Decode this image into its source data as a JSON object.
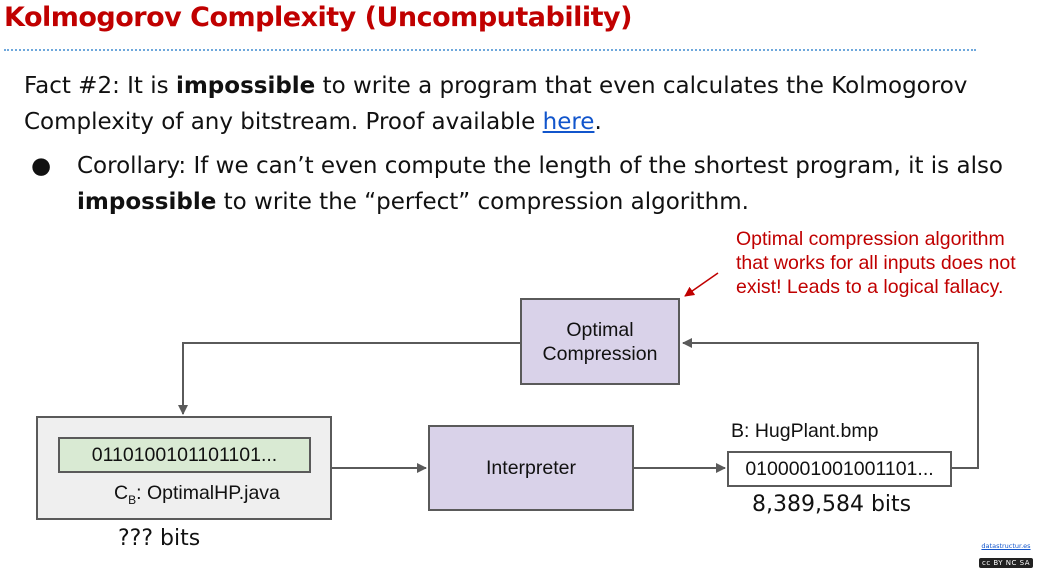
{
  "slide": {
    "title": "Kolmogorov Complexity (Uncomputability)",
    "fact": {
      "prefix": "Fact #2: It is ",
      "bold": "impossible",
      "middle": " to write a program that even calculates the Kolmogorov Complexity of any bitstream. Proof available ",
      "link": "here",
      "suffix": "."
    },
    "bullet": {
      "marker": "●",
      "prefix": "Corollary: If we can’t even compute the length of the shortest program, it is also ",
      "bold": "impossible",
      "suffix": " to write the “perfect” compression algorithm."
    }
  },
  "diagram": {
    "note": "Optimal compression algorithm that works for all inputs does not exist! Leads to a logical fallacy.",
    "optimal_line1": "Optimal",
    "optimal_line2": "Compression",
    "interpreter": "Interpreter",
    "program_bits": "0110100101101101...",
    "program_label_prefix": "C",
    "program_label_sub": "B",
    "program_label_suffix": ": OptimalHP.java",
    "program_size": "??? bits",
    "output_label": "B: HugPlant.bmp",
    "output_bits": "0100001001001101...",
    "output_size": "8,389,584 bits",
    "colors": {
      "title": "#c00000",
      "note": "#c00000",
      "box_purple": "#d9d2e9",
      "box_green": "#d9ead3",
      "box_gray": "#efefef",
      "link": "#1155cc"
    }
  },
  "footer": {
    "site": "datastructur.es",
    "license_badge": "cc BY NC SA"
  }
}
